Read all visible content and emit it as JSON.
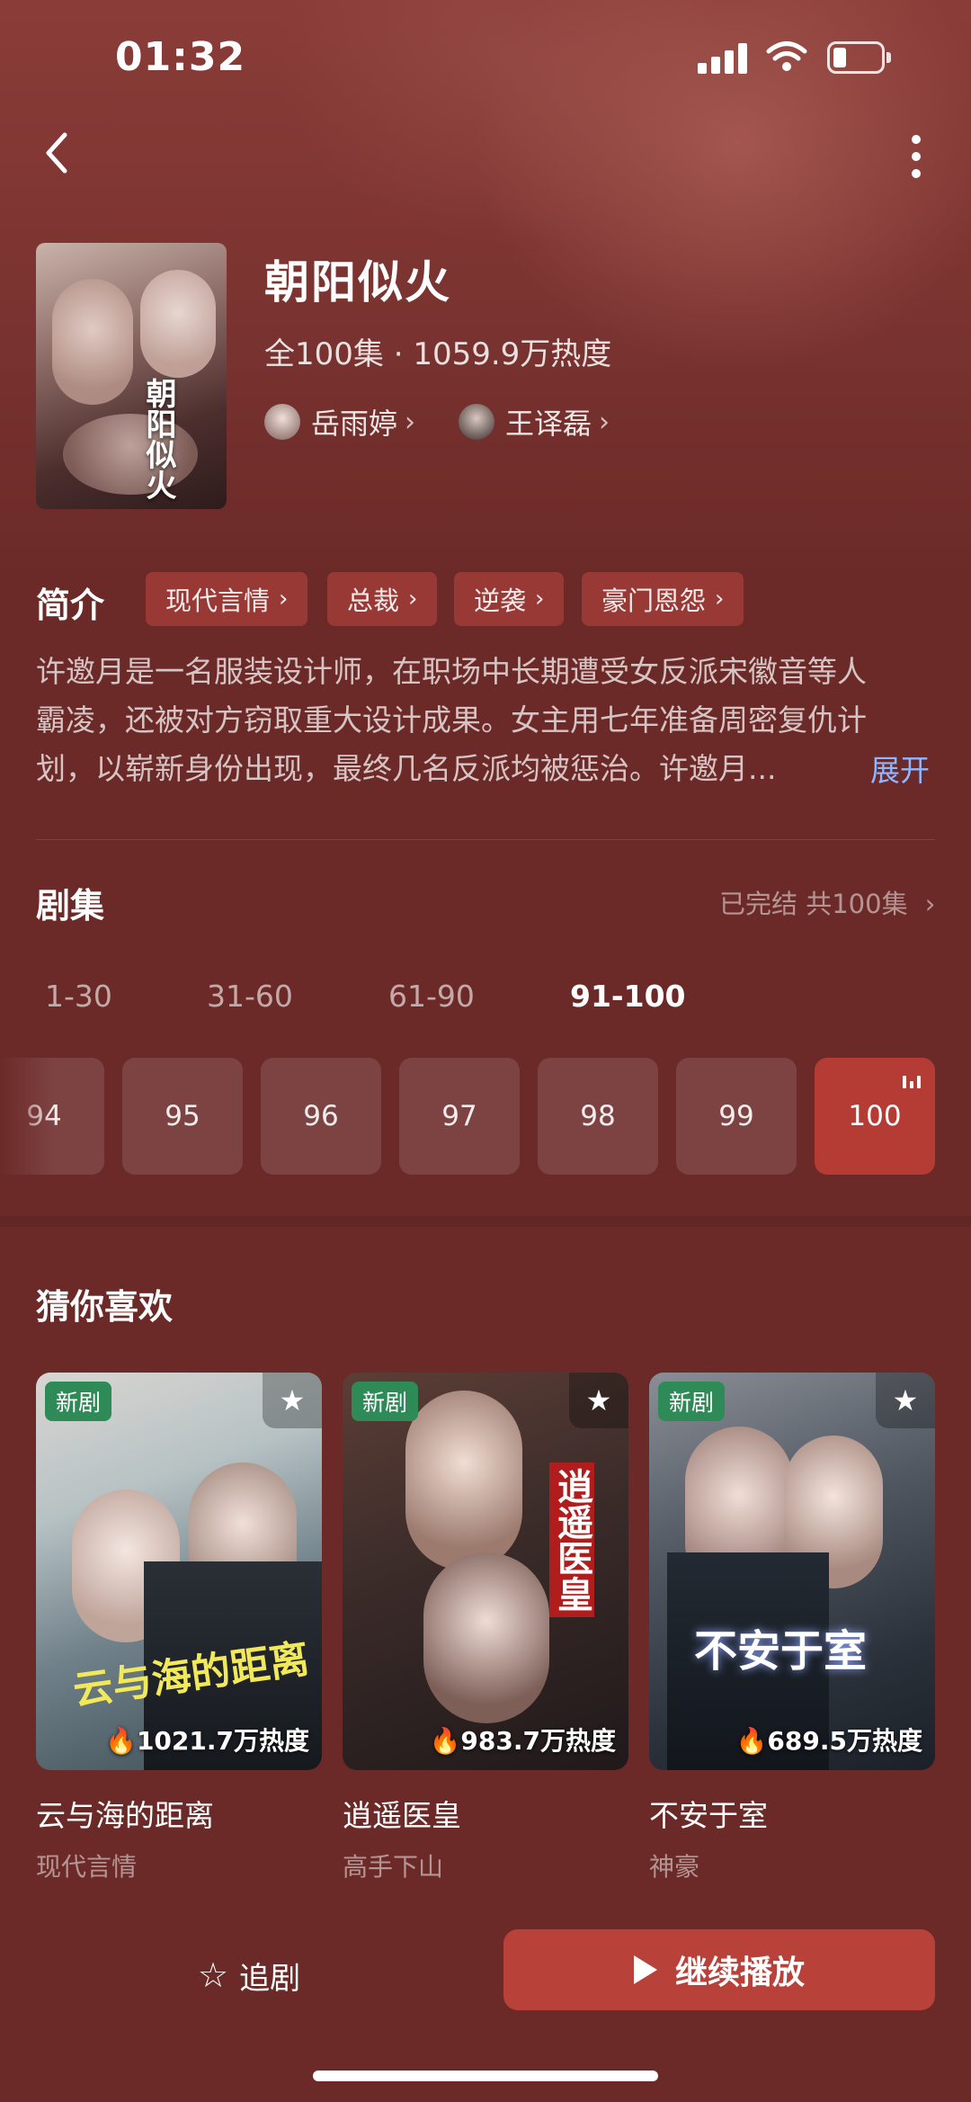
{
  "status_bar": {
    "time": "01:32"
  },
  "drama": {
    "title": "朝阳似火",
    "cover_title": "朝阳似火",
    "meta": "全100集 · 1059.9万热度",
    "actors": [
      {
        "name": "岳雨婷"
      },
      {
        "name": "王译磊"
      }
    ]
  },
  "intro": {
    "title": "简介",
    "tags": [
      "现代言情",
      "总裁",
      "逆袭",
      "豪门恩怨"
    ],
    "lines": [
      "许邀月是一名服装设计师，在职场中长期遭受女反派宋徽音等人",
      "霸凌，还被对方窃取重大设计成果。女主用七年准备周密复仇计",
      "划，以崭新身份出现，最终几名反派均被惩治。许邀月..."
    ],
    "expand_label": "展开"
  },
  "episodes": {
    "title": "剧集",
    "status": "已完结 共100集",
    "ranges": [
      "1-30",
      "31-60",
      "61-90",
      "91-100"
    ],
    "active_range": "91-100",
    "items": [
      "94",
      "95",
      "96",
      "97",
      "98",
      "99",
      "100"
    ],
    "current": "100"
  },
  "recommend": {
    "title": "猜你喜欢",
    "items": [
      {
        "badge": "新剧",
        "heat": "1021.7万热度",
        "title": "云与海的距离",
        "genre": "现代言情",
        "overlay": "云与海的距离"
      },
      {
        "badge": "新剧",
        "heat": "983.7万热度",
        "title": "逍遥医皇",
        "genre": "高手下山",
        "overlay": "逍遥医皇"
      },
      {
        "badge": "新剧",
        "heat": "689.5万热度",
        "title": "不安于室",
        "genre": "神豪",
        "overlay": "不安于室"
      }
    ]
  },
  "bottom_bar": {
    "follow_label": "追剧",
    "play_label": "继续播放"
  }
}
